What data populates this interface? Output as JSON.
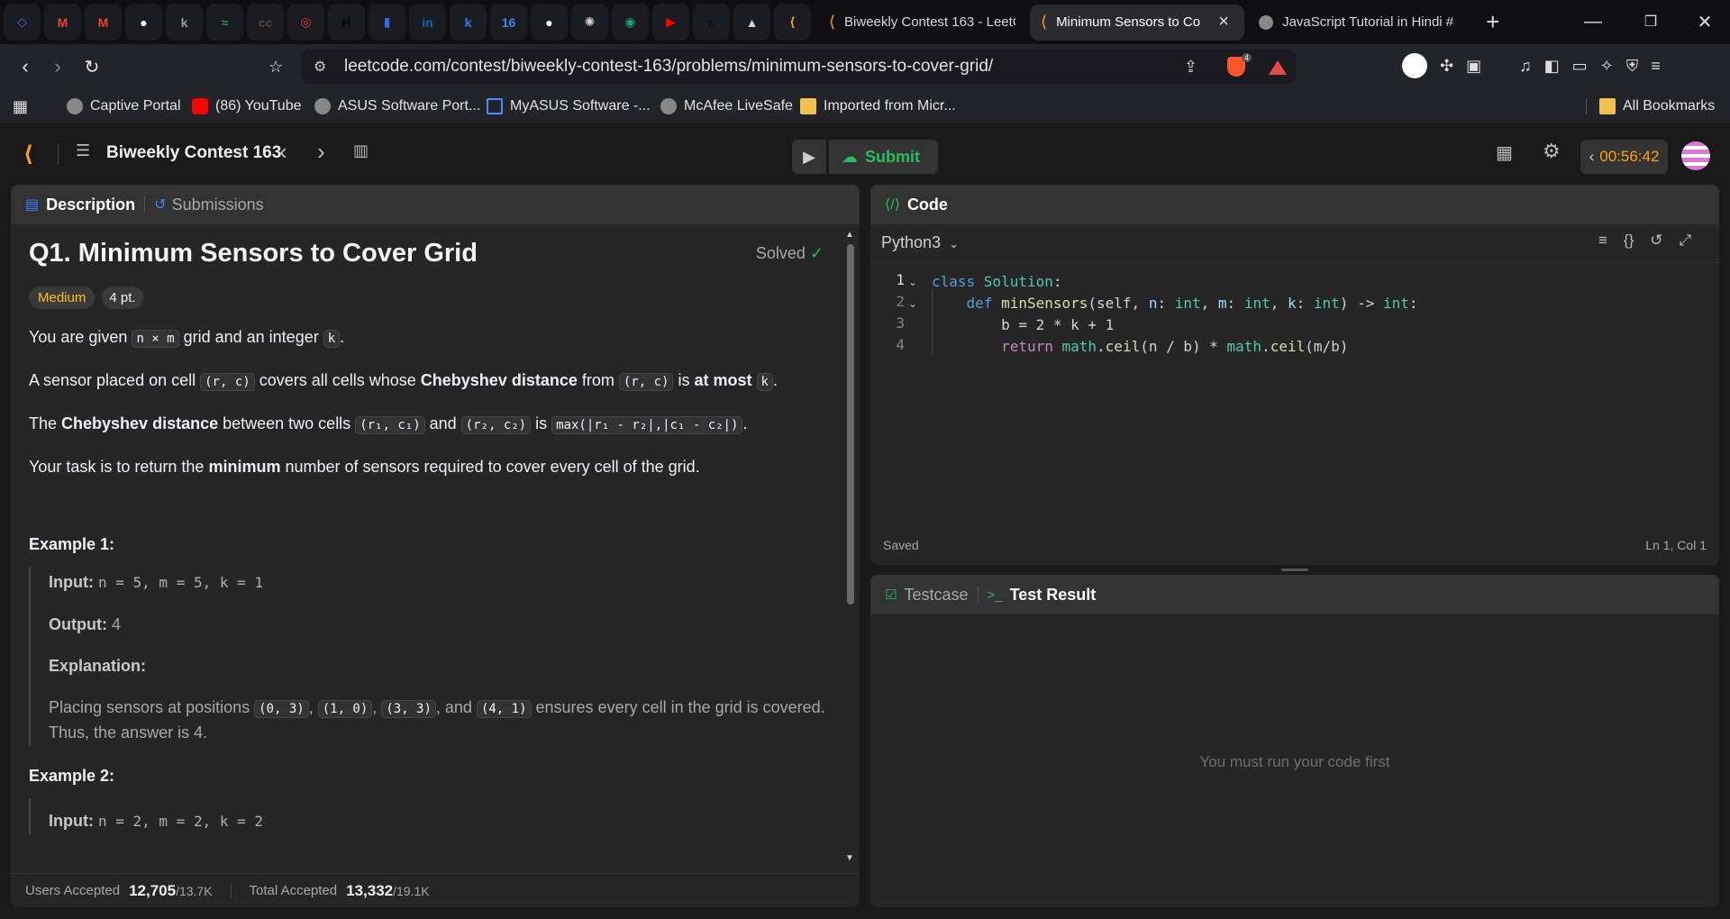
{
  "browser": {
    "pinned_tabs": [
      {
        "icon": "hexagon-logo-icon",
        "color": "#6b5bff",
        "glyph": "◇"
      },
      {
        "icon": "gmail-icon",
        "color": "#ea4335",
        "glyph": "M"
      },
      {
        "icon": "gmail-icon",
        "color": "#ea4335",
        "glyph": "M"
      },
      {
        "icon": "github-icon",
        "color": "#ffffff",
        "glyph": "●"
      },
      {
        "icon": "k-icon",
        "color": "#9a9a9a",
        "glyph": "k"
      },
      {
        "icon": "gfg-icon",
        "color": "#2f8d46",
        "glyph": "≈"
      },
      {
        "icon": "cc-icon",
        "color": "#5b4636",
        "glyph": "cc"
      },
      {
        "icon": "target-icon",
        "color": "#e03a3a",
        "glyph": "◎"
      },
      {
        "icon": "hackerrank-icon",
        "color": "#0a0a0a",
        "glyph": "H"
      },
      {
        "icon": "chart-icon",
        "color": "#2c6bed",
        "glyph": "▮"
      },
      {
        "icon": "linkedin-icon",
        "color": "#0a66c2",
        "glyph": "in"
      },
      {
        "icon": "blue-app-icon",
        "color": "#3478f6",
        "glyph": "k"
      },
      {
        "icon": "calendar-icon",
        "color": "#4285f4",
        "glyph": "16"
      },
      {
        "icon": "github-icon",
        "color": "#ffffff",
        "glyph": "●"
      },
      {
        "icon": "openai-icon",
        "color": "#d0d0d0",
        "glyph": "✺"
      },
      {
        "icon": "chat-icon",
        "color": "#10a37f",
        "glyph": "◉"
      },
      {
        "icon": "youtube-icon",
        "color": "#ff0000",
        "glyph": "▶"
      },
      {
        "icon": "r-icon",
        "color": "#111111",
        "glyph": "r."
      },
      {
        "icon": "rocket-icon",
        "color": "#cfd2d8",
        "glyph": "▲"
      },
      {
        "icon": "leetcode-icon",
        "color": "#ffa116",
        "glyph": "⟨"
      }
    ],
    "tabs": [
      {
        "title": "Biweekly Contest 163 - LeetC"
      },
      {
        "title": "Minimum Sensors to Co"
      },
      {
        "title": "JavaScript Tutorial in Hindi #"
      }
    ],
    "url": "leetcode.com/contest/biweekly-contest-163/problems/minimum-sensors-to-cover-grid/",
    "brave_badge": "4",
    "bookmarks": [
      {
        "label": "Captive Portal",
        "icon": "globe-icon"
      },
      {
        "label": "(86) YouTube",
        "icon": "youtube-icon"
      },
      {
        "label": "ASUS Software Port...",
        "icon": "globe-icon"
      },
      {
        "label": "MyASUS Software -...",
        "icon": "asus-icon"
      },
      {
        "label": "McAfee LiveSafe",
        "icon": "globe-icon"
      },
      {
        "label": "Imported from Micr...",
        "icon": "folder-icon"
      }
    ],
    "all_bookmarks": "All Bookmarks"
  },
  "header": {
    "contest": "Biweekly Contest 163",
    "submit": "Submit",
    "timer": "00:56:42"
  },
  "description": {
    "tab_description": "Description",
    "tab_submissions": "Submissions",
    "title": "Q1. Minimum Sensors to Cover Grid",
    "solved": "Solved",
    "difficulty": "Medium",
    "points": "4 pt.",
    "p1": {
      "a": "You are given ",
      "c1": "n × m",
      "b": " grid and an integer ",
      "c2": "k",
      "d": "."
    },
    "p2": {
      "a": "A sensor placed on cell ",
      "c1": "(r, c)",
      "b": " covers all cells whose ",
      "s1": "Chebyshev distance",
      "c": " from ",
      "c2": "(r, c)",
      "d": " is ",
      "s2": "at most",
      "e": " ",
      "c3": "k",
      "f": "."
    },
    "p3": {
      "a": "The ",
      "s1": "Chebyshev distance",
      "b": " between two cells ",
      "c1": "(r₁, c₁)",
      "c": " and ",
      "c2": "(r₂, c₂)",
      "d": " is ",
      "c3": "max(|r₁ - r₂|,|c₁ - c₂|)",
      "e": "."
    },
    "p4": {
      "a": "Your task is to return the ",
      "s1": "minimum",
      "b": " number of sensors required to cover every cell of the grid."
    },
    "example1": {
      "heading": "Example 1:",
      "input_label": "Input:",
      "input": "n = 5, m = 5, k = 1",
      "output_label": "Output:",
      "output": "4",
      "explanation_label": "Explanation:",
      "exp_a": "Placing sensors at positions ",
      "pos1": "(0, 3)",
      "sep1": ", ",
      "pos2": "(1, 0)",
      "sep2": ", ",
      "pos3": "(3, 3)",
      "sep3": ", and ",
      "pos4": "(4, 1)",
      "exp_b": " ensures every cell in the grid is covered. Thus, the answer is 4."
    },
    "example2": {
      "heading": "Example 2:",
      "input_label": "Input:",
      "input": "n = 2, m = 2, k = 2"
    },
    "footer": {
      "users_label": "Users Accepted",
      "users_value": "12,705",
      "users_total": "/13.7K",
      "total_label": "Total Accepted",
      "total_value": "13,332",
      "total_total": "/19.1K"
    }
  },
  "code": {
    "tab": "Code",
    "language": "Python3",
    "lines": [
      {
        "n": "1",
        "indent": "",
        "t": [
          [
            "class ",
            "kw"
          ],
          [
            "Solution",
            "cls"
          ],
          [
            ":",
            "p"
          ]
        ]
      },
      {
        "n": "2",
        "indent": "    ",
        "t": [
          [
            "def ",
            "kw"
          ],
          [
            "minSensors",
            "fn"
          ],
          [
            "(self, ",
            "p"
          ],
          [
            "n",
            "v"
          ],
          [
            ": ",
            "p"
          ],
          [
            "int",
            "cls"
          ],
          [
            ", ",
            "p"
          ],
          [
            "m",
            "v"
          ],
          [
            ": ",
            "p"
          ],
          [
            "int",
            "cls"
          ],
          [
            ", ",
            "p"
          ],
          [
            "k",
            "v"
          ],
          [
            ": ",
            "p"
          ],
          [
            "int",
            "cls"
          ],
          [
            ") -> ",
            "p"
          ],
          [
            "int",
            "cls"
          ],
          [
            ":",
            "p"
          ]
        ]
      },
      {
        "n": "3",
        "indent": "        ",
        "t": [
          [
            "b = 2 * k + 1",
            "p"
          ]
        ]
      },
      {
        "n": "4",
        "indent": "        ",
        "t": [
          [
            "return ",
            "ret"
          ],
          [
            "math",
            "cls"
          ],
          [
            ".",
            "p"
          ],
          [
            "ceil",
            "fn"
          ],
          [
            "(n / b) * ",
            "p"
          ],
          [
            "math",
            "cls"
          ],
          [
            ".",
            "p"
          ],
          [
            "ceil",
            "fn"
          ],
          [
            "(m/b)",
            "p"
          ]
        ]
      }
    ],
    "saved": "Saved",
    "cursor": "Ln 1, Col 1"
  },
  "result": {
    "tab_testcase": "Testcase",
    "tab_result": "Test Result",
    "empty": "You must run your code first"
  },
  "colors": {
    "accent_green": "#2cbb5d",
    "medium": "#ffc01e",
    "timer": "#ffa116"
  }
}
